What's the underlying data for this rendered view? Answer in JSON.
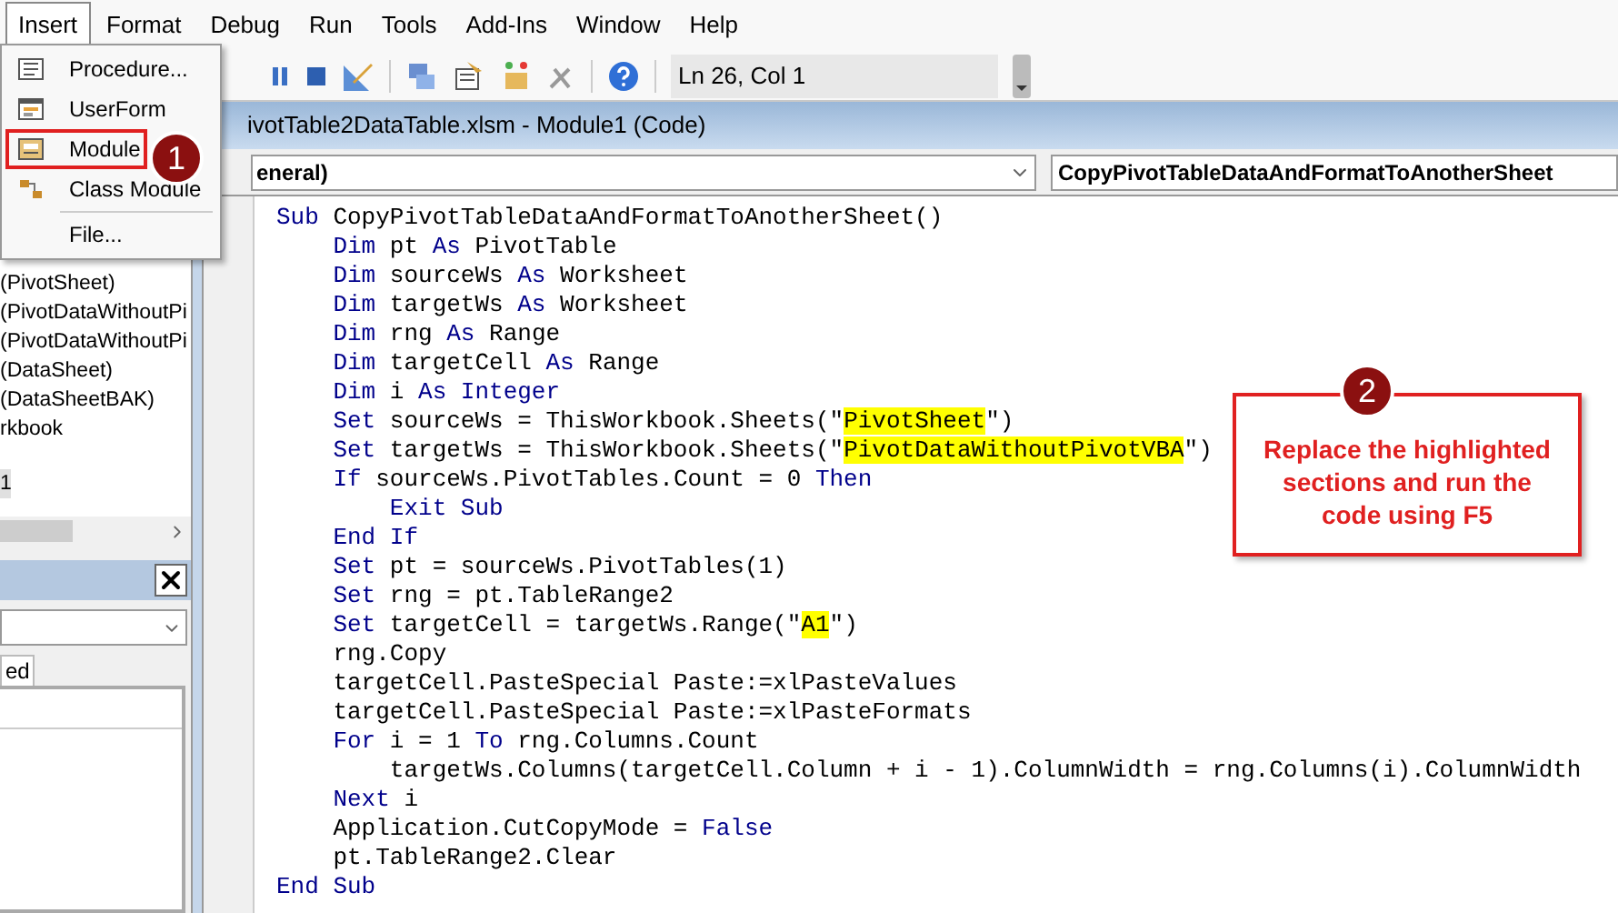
{
  "menu_bar": [
    {
      "label": "Insert",
      "open": true
    },
    {
      "label": "Format",
      "open": false
    },
    {
      "label": "Debug",
      "open": false
    },
    {
      "label": "Run",
      "open": false
    },
    {
      "label": "Tools",
      "open": false
    },
    {
      "label": "Add-Ins",
      "open": false
    },
    {
      "label": "Window",
      "open": false
    },
    {
      "label": "Help",
      "open": false
    }
  ],
  "insert_menu": {
    "items": [
      {
        "label": "Procedure...",
        "kind": "procedure",
        "outlined": false,
        "separator_before": false
      },
      {
        "label": "UserForm",
        "kind": "userform",
        "outlined": false,
        "separator_before": false
      },
      {
        "label": "Module",
        "kind": "module",
        "outlined": true,
        "separator_before": false
      },
      {
        "label": "Class Module",
        "kind": "class",
        "outlined": false,
        "separator_before": false
      },
      {
        "label": "File...",
        "kind": "file",
        "outlined": false,
        "separator_before": true
      }
    ]
  },
  "toolbar": {
    "position": "Ln 26, Col 1"
  },
  "project_tree": {
    "items": [
      {
        "label": "(PivotSheet)",
        "selected": false
      },
      {
        "label": "(PivotDataWithoutPi",
        "selected": false
      },
      {
        "label": "(PivotDataWithoutPi",
        "selected": false
      },
      {
        "label": "(DataSheet)",
        "selected": false
      },
      {
        "label": "(DataSheetBAK)",
        "selected": false
      },
      {
        "label": "rkbook",
        "selected": false
      },
      {
        "label": "1",
        "selected": true
      }
    ]
  },
  "properties": {
    "tab": "ed"
  },
  "code_window": {
    "title": "ivotTable2DataTable.xlsm - Module1 (Code)",
    "object": "eneral)",
    "procedure": "CopyPivotTableDataAndFormatToAnotherSheet",
    "lines": [
      [
        {
          "text": "Sub",
          "kind": "keyword"
        },
        {
          "text": " CopyPivotTableDataAndFormatToAnotherSheet()",
          "kind": "plain"
        }
      ],
      [
        {
          "text": "    Dim",
          "kind": "keyword"
        },
        {
          "text": " pt ",
          "kind": "plain"
        },
        {
          "text": "As",
          "kind": "keyword"
        },
        {
          "text": " PivotTable",
          "kind": "plain"
        }
      ],
      [
        {
          "text": "    Dim",
          "kind": "keyword"
        },
        {
          "text": " sourceWs ",
          "kind": "plain"
        },
        {
          "text": "As",
          "kind": "keyword"
        },
        {
          "text": " Worksheet",
          "kind": "plain"
        }
      ],
      [
        {
          "text": "    Dim",
          "kind": "keyword"
        },
        {
          "text": " targetWs ",
          "kind": "plain"
        },
        {
          "text": "As",
          "kind": "keyword"
        },
        {
          "text": " Worksheet",
          "kind": "plain"
        }
      ],
      [
        {
          "text": "    Dim",
          "kind": "keyword"
        },
        {
          "text": " rng ",
          "kind": "plain"
        },
        {
          "text": "As",
          "kind": "keyword"
        },
        {
          "text": " Range",
          "kind": "plain"
        }
      ],
      [
        {
          "text": "    Dim",
          "kind": "keyword"
        },
        {
          "text": " targetCell ",
          "kind": "plain"
        },
        {
          "text": "As",
          "kind": "keyword"
        },
        {
          "text": " Range",
          "kind": "plain"
        }
      ],
      [
        {
          "text": "    Dim",
          "kind": "keyword"
        },
        {
          "text": " i ",
          "kind": "plain"
        },
        {
          "text": "As Integer",
          "kind": "keyword"
        }
      ],
      [
        {
          "text": "    Set",
          "kind": "keyword"
        },
        {
          "text": " sourceWs = ThisWorkbook.Sheets(\"",
          "kind": "plain"
        },
        {
          "text": "PivotSheet",
          "kind": "highlight"
        },
        {
          "text": "\")",
          "kind": "plain"
        }
      ],
      [
        {
          "text": "    Set",
          "kind": "keyword"
        },
        {
          "text": " targetWs = ThisWorkbook.Sheets(\"",
          "kind": "plain"
        },
        {
          "text": "PivotDataWithoutPivotVBA",
          "kind": "highlight"
        },
        {
          "text": "\")",
          "kind": "plain"
        }
      ],
      [
        {
          "text": "    If",
          "kind": "keyword"
        },
        {
          "text": " sourceWs.PivotTables.Count = 0 ",
          "kind": "plain"
        },
        {
          "text": "Then",
          "kind": "keyword"
        }
      ],
      [
        {
          "text": "        Exit Sub",
          "kind": "keyword"
        }
      ],
      [
        {
          "text": "    End If",
          "kind": "keyword"
        }
      ],
      [
        {
          "text": "    Set",
          "kind": "keyword"
        },
        {
          "text": " pt = sourceWs.PivotTables(1)",
          "kind": "plain"
        }
      ],
      [
        {
          "text": "    Set",
          "kind": "keyword"
        },
        {
          "text": " rng = pt.TableRange2",
          "kind": "plain"
        }
      ],
      [
        {
          "text": "    Set",
          "kind": "keyword"
        },
        {
          "text": " targetCell = targetWs.Range(\"",
          "kind": "plain"
        },
        {
          "text": "A1",
          "kind": "highlight"
        },
        {
          "text": "\")",
          "kind": "plain"
        }
      ],
      [
        {
          "text": "    rng.Copy",
          "kind": "plain"
        }
      ],
      [
        {
          "text": "    targetCell.PasteSpecial Paste:=xlPasteValues",
          "kind": "plain"
        }
      ],
      [
        {
          "text": "    targetCell.PasteSpecial Paste:=xlPasteFormats",
          "kind": "plain"
        }
      ],
      [
        {
          "text": "    For",
          "kind": "keyword"
        },
        {
          "text": " i = 1 ",
          "kind": "plain"
        },
        {
          "text": "To",
          "kind": "keyword"
        },
        {
          "text": " rng.Columns.Count",
          "kind": "plain"
        }
      ],
      [
        {
          "text": "        targetWs.Columns(targetCell.Column + i - 1).ColumnWidth = rng.Columns(i).ColumnWidth",
          "kind": "plain"
        }
      ],
      [
        {
          "text": "    Next",
          "kind": "keyword"
        },
        {
          "text": " i",
          "kind": "plain"
        }
      ],
      [
        {
          "text": "    Application.CutCopyMode = ",
          "kind": "plain"
        },
        {
          "text": "False",
          "kind": "keyword"
        }
      ],
      [
        {
          "text": "    pt.TableRange2.Clear",
          "kind": "plain"
        }
      ],
      [
        {
          "text": "End Sub",
          "kind": "keyword"
        }
      ]
    ]
  },
  "annotations": [
    {
      "number": "1"
    },
    {
      "number": "2",
      "text": "Replace the highlighted sections and run the code using F5"
    }
  ]
}
